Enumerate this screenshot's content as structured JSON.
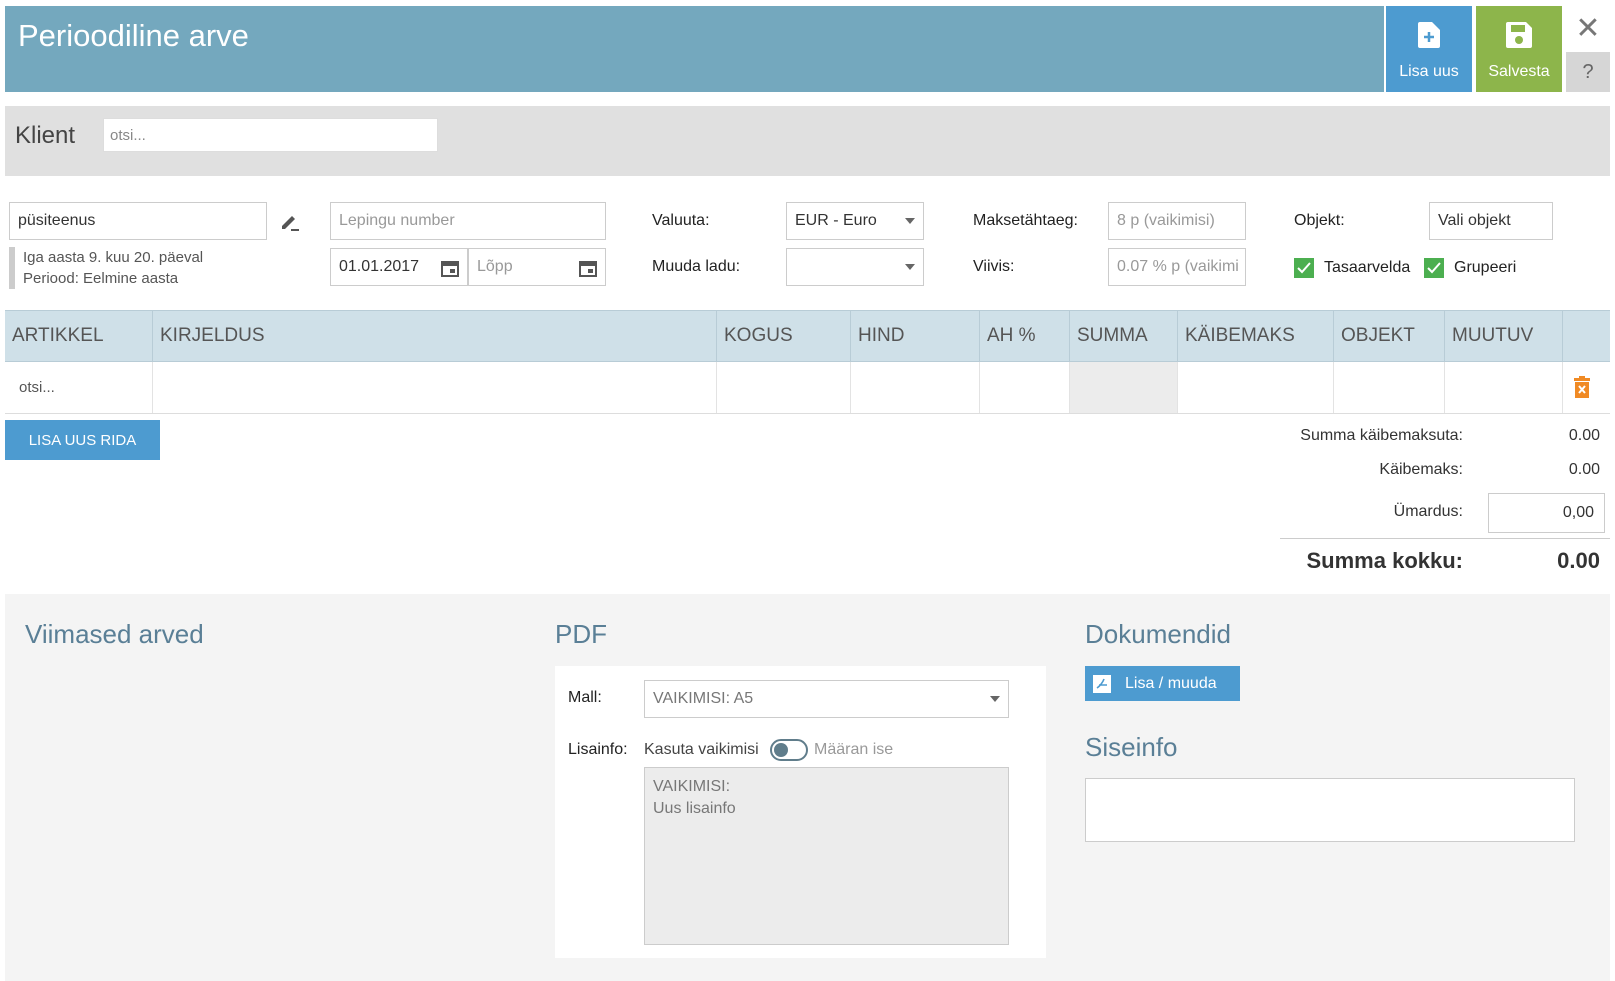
{
  "header": {
    "title": "Perioodiline arve",
    "add_label": "Lisa uus",
    "save_label": "Salvesta",
    "close_glyph": "✕",
    "help_glyph": "?"
  },
  "client": {
    "label": "Klient",
    "placeholder": "otsi..."
  },
  "service": {
    "value": "püsiteenus",
    "note_line1": "Iga aasta 9. kuu 20. päeval",
    "note_line2": "Periood: Eelmine aasta"
  },
  "contract": {
    "number_placeholder": "Lepingu number",
    "start_date": "01.01.2017",
    "end_placeholder": "Lõpp"
  },
  "currency": {
    "label": "Valuuta:",
    "value": "EUR - Euro",
    "warehouse_label": "Muuda ladu:",
    "warehouse_value": ""
  },
  "payment": {
    "due_label": "Maksetähtaeg:",
    "due_placeholder": "8 p (vaikimisi)",
    "penalty_label": "Viivis:",
    "penalty_placeholder": "0.07 % p (vaikimi"
  },
  "object": {
    "label": "Objekt:",
    "value": "Vali objekt",
    "offset_label": "Tasaarvelda",
    "group_label": "Grupeeri"
  },
  "table": {
    "headers": [
      "ARTIKKEL",
      "KIRJELDUS",
      "KOGUS",
      "HIND",
      "AH %",
      "SUMMA",
      "KÄIBEMAKS",
      "OBJEKT",
      "MUUTUV"
    ],
    "row_placeholder": "otsi..."
  },
  "add_row_label": "LISA UUS RIDA",
  "totals": {
    "subtotal_label": "Summa käibemaksuta:",
    "subtotal_value": "0.00",
    "vat_label": "Käibemaks:",
    "vat_value": "0.00",
    "rounding_label": "Ümardus:",
    "rounding_value": "0,00",
    "total_label": "Summa kokku:",
    "total_value": "0.00"
  },
  "recent": {
    "title": "Viimased arved"
  },
  "pdf": {
    "title": "PDF",
    "template_label": "Mall:",
    "template_value": "VAIKIMISI: A5",
    "info_label": "Lisainfo:",
    "use_default_label": "Kasuta vaikimisi",
    "set_own_label": "Määran ise",
    "info_line1": "VAIKIMISI:",
    "info_line2": "Uus lisainfo"
  },
  "documents": {
    "title": "Dokumendid",
    "button_label": "Lisa / muuda"
  },
  "internal": {
    "title": "Siseinfo"
  },
  "colors": {
    "header": "#74a8be",
    "add_button": "#4d9bd0",
    "save_button": "#8db54b",
    "checkbox": "#4caf50",
    "delete": "#f08a24"
  }
}
